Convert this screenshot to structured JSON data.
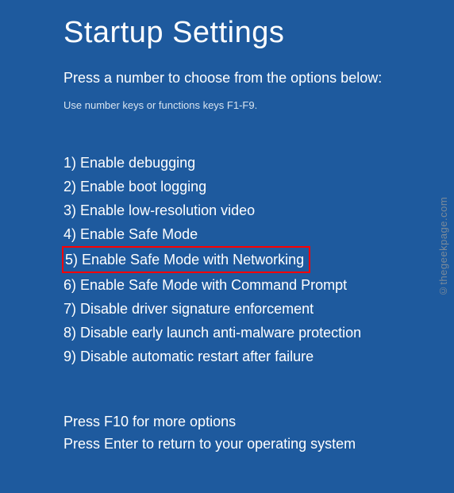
{
  "title": "Startup Settings",
  "subtitle": "Press a number to choose from the options below:",
  "hint": "Use number keys or functions keys F1-F9.",
  "options": [
    {
      "num": "1",
      "label": "Enable debugging",
      "highlight": false
    },
    {
      "num": "2",
      "label": "Enable boot logging",
      "highlight": false
    },
    {
      "num": "3",
      "label": "Enable low-resolution video",
      "highlight": false
    },
    {
      "num": "4",
      "label": "Enable Safe Mode",
      "highlight": false
    },
    {
      "num": "5",
      "label": "Enable Safe Mode with Networking",
      "highlight": true
    },
    {
      "num": "6",
      "label": "Enable Safe Mode with Command Prompt",
      "highlight": false
    },
    {
      "num": "7",
      "label": "Disable driver signature enforcement",
      "highlight": false
    },
    {
      "num": "8",
      "label": "Disable early launch anti-malware protection",
      "highlight": false
    },
    {
      "num": "9",
      "label": "Disable automatic restart after failure",
      "highlight": false
    }
  ],
  "footer": {
    "line1": "Press F10 for more options",
    "line2": "Press Enter to return to your operating system"
  },
  "watermark": "©thegeekpage.com"
}
